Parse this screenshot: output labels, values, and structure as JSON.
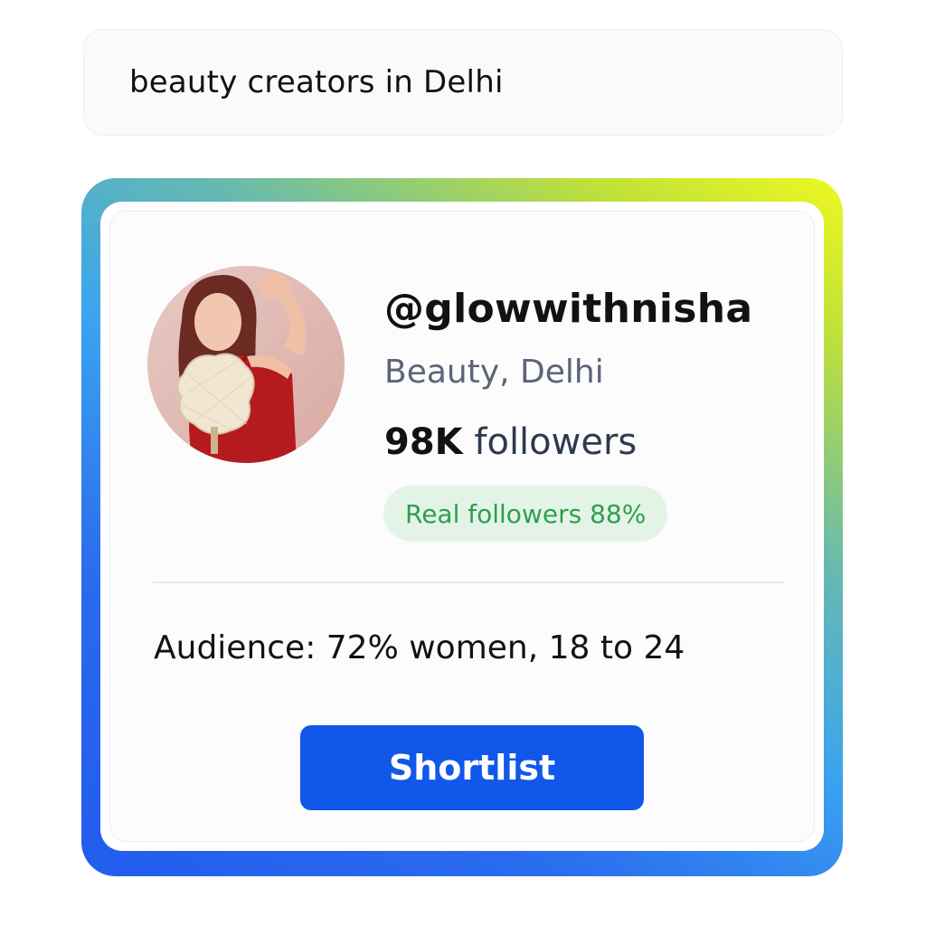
{
  "search": {
    "query": "beauty creators in Delhi"
  },
  "profile": {
    "handle": "@glowwithnisha",
    "category": "Beauty, Delhi",
    "followers_count": "98K",
    "followers_label": "followers",
    "real_followers_badge": "Real followers 88%",
    "audience": "Audience: 72% women, 18 to 24",
    "avatar_icon": "profile-photo"
  },
  "actions": {
    "shortlist_label": "Shortlist"
  },
  "colors": {
    "accent": "#1157ea",
    "badge_bg": "#e3f4e7",
    "badge_text": "#2f9e4f",
    "frame_gradient_start": "#1f4fe6",
    "frame_gradient_end": "#eef820"
  }
}
